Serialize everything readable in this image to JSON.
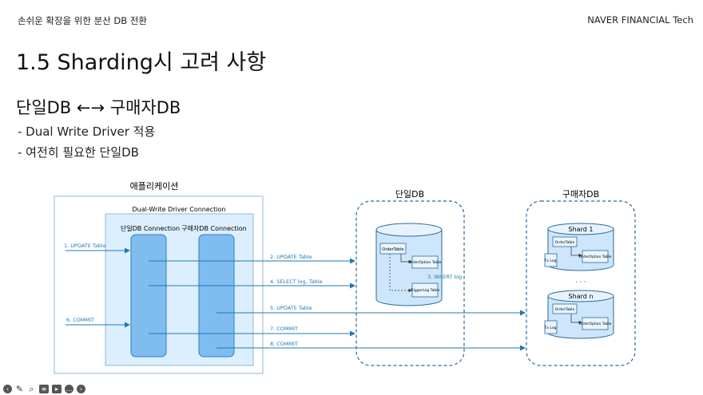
{
  "header": {
    "left": "손쉬운 확장을 위한 분산 DB 전환",
    "right": "NAVER FINANCIAL Tech"
  },
  "title": "1.5 Sharding시 고려 사항",
  "subtitle": "단일DB ←→ 구매자DB",
  "bullets": [
    "- Dual Write Driver 적용",
    "- 여전히 필요한 단일DB"
  ],
  "diagram": {
    "app_label": "애플리케이션",
    "driver_label": "Dual-Write Driver Connection",
    "conn_single": "단일DB Connection",
    "conn_buyer": "구매자DB Connection",
    "db_single": "단일DB",
    "db_buyer": "구매자DB",
    "shard1": "Shard 1",
    "shardn": "Shard n",
    "dots": "·  ·  ·",
    "order_table": "OrderTable",
    "order_option_table": "OrderOption Table",
    "trigger_log_table": "TriggerLog Table",
    "tx_log": "Tx Log",
    "insert_log": "3. INSERT log",
    "steps": [
      "1. UPDATE Table",
      "2. UPDATE Table",
      "4. SELECT log, Table",
      "5. UPDATE Table",
      "6. COMMIT",
      "7. COMMIT",
      "8. COMMIT"
    ]
  },
  "colors": {
    "accent": "#1f78b4",
    "box_fill": "#dcefff",
    "conn_fill": "#7fbdf0",
    "db_fill": "#cde6fb"
  }
}
